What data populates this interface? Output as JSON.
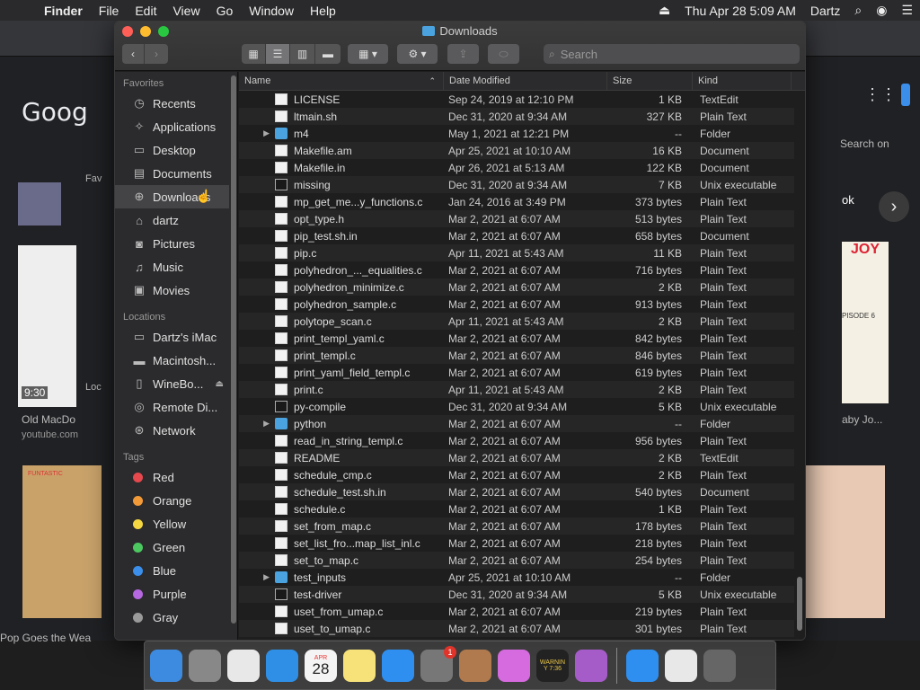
{
  "menubar": {
    "app": "Finder",
    "items": [
      "File",
      "Edit",
      "View",
      "Go",
      "Window",
      "Help"
    ],
    "clock": "Thu Apr 28  5:09 AM",
    "user": "Dartz"
  },
  "background": {
    "google": "Goog",
    "search_on": "Search on",
    "video_time": "9:30",
    "video_title": "Old MacDo",
    "video_source": "youtube.com",
    "bottom_caption": "Pop Goes the Wea",
    "right_caption": "aby Jo...",
    "right_caption2": "ok",
    "sidebar_hint": "Fav",
    "loc_hint": "Loc",
    "thumb_label": "JOY",
    "thumb_label2": "PISODE 6",
    "thumb_label3": "FUNTASTIC"
  },
  "finder": {
    "title": "Downloads",
    "search_placeholder": "Search",
    "columns": {
      "name": "Name",
      "date": "Date Modified",
      "size": "Size",
      "kind": "Kind"
    },
    "sidebar": {
      "favorites_label": "Favorites",
      "favorites": [
        {
          "label": "Recents",
          "icon": "clock-icon"
        },
        {
          "label": "Applications",
          "icon": "applications-icon"
        },
        {
          "label": "Desktop",
          "icon": "desktop-icon"
        },
        {
          "label": "Documents",
          "icon": "documents-icon"
        },
        {
          "label": "Downloads",
          "icon": "downloads-icon"
        },
        {
          "label": "dartz",
          "icon": "home-icon"
        },
        {
          "label": "Pictures",
          "icon": "pictures-icon"
        },
        {
          "label": "Music",
          "icon": "music-icon"
        },
        {
          "label": "Movies",
          "icon": "movies-icon"
        }
      ],
      "locations_label": "Locations",
      "locations": [
        {
          "label": "Dartz's iMac",
          "icon": "imac-icon"
        },
        {
          "label": "Macintosh...",
          "icon": "disk-icon"
        },
        {
          "label": "WineBo...",
          "icon": "drive-icon"
        },
        {
          "label": "Remote Di...",
          "icon": "disc-icon"
        },
        {
          "label": "Network",
          "icon": "network-icon"
        }
      ],
      "tags_label": "Tags",
      "tags": [
        {
          "label": "Red",
          "color": "#e5484d"
        },
        {
          "label": "Orange",
          "color": "#f29a38"
        },
        {
          "label": "Yellow",
          "color": "#f5d742"
        },
        {
          "label": "Green",
          "color": "#4cc861"
        },
        {
          "label": "Blue",
          "color": "#3b8eea"
        },
        {
          "label": "Purple",
          "color": "#b568e0"
        },
        {
          "label": "Gray",
          "color": "#9a9a9a"
        }
      ]
    },
    "files": [
      {
        "name": "LICENSE",
        "date": "Sep 24, 2019 at 12:10 PM",
        "size": "1 KB",
        "kind": "TextEdit",
        "type": "doc"
      },
      {
        "name": "ltmain.sh",
        "date": "Dec 31, 2020 at 9:34 AM",
        "size": "327 KB",
        "kind": "Plain Text",
        "type": "doc"
      },
      {
        "name": "m4",
        "date": "May 1, 2021 at 12:21 PM",
        "size": "--",
        "kind": "Folder",
        "type": "folder"
      },
      {
        "name": "Makefile.am",
        "date": "Apr 25, 2021 at 10:10 AM",
        "size": "16 KB",
        "kind": "Document",
        "type": "doc"
      },
      {
        "name": "Makefile.in",
        "date": "Apr 26, 2021 at 5:13 AM",
        "size": "122 KB",
        "kind": "Document",
        "type": "doc"
      },
      {
        "name": "missing",
        "date": "Dec 31, 2020 at 9:34 AM",
        "size": "7 KB",
        "kind": "Unix executable",
        "type": "exec"
      },
      {
        "name": "mp_get_me...y_functions.c",
        "date": "Jan 24, 2016 at 3:49 PM",
        "size": "373 bytes",
        "kind": "Plain Text",
        "type": "doc"
      },
      {
        "name": "opt_type.h",
        "date": "Mar 2, 2021 at 6:07 AM",
        "size": "513 bytes",
        "kind": "Plain Text",
        "type": "doc"
      },
      {
        "name": "pip_test.sh.in",
        "date": "Mar 2, 2021 at 6:07 AM",
        "size": "658 bytes",
        "kind": "Document",
        "type": "doc"
      },
      {
        "name": "pip.c",
        "date": "Apr 11, 2021 at 5:43 AM",
        "size": "11 KB",
        "kind": "Plain Text",
        "type": "doc"
      },
      {
        "name": "polyhedron_..._equalities.c",
        "date": "Mar 2, 2021 at 6:07 AM",
        "size": "716 bytes",
        "kind": "Plain Text",
        "type": "doc"
      },
      {
        "name": "polyhedron_minimize.c",
        "date": "Mar 2, 2021 at 6:07 AM",
        "size": "2 KB",
        "kind": "Plain Text",
        "type": "doc"
      },
      {
        "name": "polyhedron_sample.c",
        "date": "Mar 2, 2021 at 6:07 AM",
        "size": "913 bytes",
        "kind": "Plain Text",
        "type": "doc"
      },
      {
        "name": "polytope_scan.c",
        "date": "Apr 11, 2021 at 5:43 AM",
        "size": "2 KB",
        "kind": "Plain Text",
        "type": "doc"
      },
      {
        "name": "print_templ_yaml.c",
        "date": "Mar 2, 2021 at 6:07 AM",
        "size": "842 bytes",
        "kind": "Plain Text",
        "type": "doc"
      },
      {
        "name": "print_templ.c",
        "date": "Mar 2, 2021 at 6:07 AM",
        "size": "846 bytes",
        "kind": "Plain Text",
        "type": "doc"
      },
      {
        "name": "print_yaml_field_templ.c",
        "date": "Mar 2, 2021 at 6:07 AM",
        "size": "619 bytes",
        "kind": "Plain Text",
        "type": "doc"
      },
      {
        "name": "print.c",
        "date": "Apr 11, 2021 at 5:43 AM",
        "size": "2 KB",
        "kind": "Plain Text",
        "type": "doc"
      },
      {
        "name": "py-compile",
        "date": "Dec 31, 2020 at 9:34 AM",
        "size": "5 KB",
        "kind": "Unix executable",
        "type": "exec"
      },
      {
        "name": "python",
        "date": "Mar 2, 2021 at 6:07 AM",
        "size": "--",
        "kind": "Folder",
        "type": "folder"
      },
      {
        "name": "read_in_string_templ.c",
        "date": "Mar 2, 2021 at 6:07 AM",
        "size": "956 bytes",
        "kind": "Plain Text",
        "type": "doc"
      },
      {
        "name": "README",
        "date": "Mar 2, 2021 at 6:07 AM",
        "size": "2 KB",
        "kind": "TextEdit",
        "type": "doc"
      },
      {
        "name": "schedule_cmp.c",
        "date": "Mar 2, 2021 at 6:07 AM",
        "size": "2 KB",
        "kind": "Plain Text",
        "type": "doc"
      },
      {
        "name": "schedule_test.sh.in",
        "date": "Mar 2, 2021 at 6:07 AM",
        "size": "540 bytes",
        "kind": "Document",
        "type": "doc"
      },
      {
        "name": "schedule.c",
        "date": "Mar 2, 2021 at 6:07 AM",
        "size": "1 KB",
        "kind": "Plain Text",
        "type": "doc"
      },
      {
        "name": "set_from_map.c",
        "date": "Mar 2, 2021 at 6:07 AM",
        "size": "178 bytes",
        "kind": "Plain Text",
        "type": "doc"
      },
      {
        "name": "set_list_fro...map_list_inl.c",
        "date": "Mar 2, 2021 at 6:07 AM",
        "size": "218 bytes",
        "kind": "Plain Text",
        "type": "doc"
      },
      {
        "name": "set_to_map.c",
        "date": "Mar 2, 2021 at 6:07 AM",
        "size": "254 bytes",
        "kind": "Plain Text",
        "type": "doc"
      },
      {
        "name": "test_inputs",
        "date": "Apr 25, 2021 at 10:10 AM",
        "size": "--",
        "kind": "Folder",
        "type": "folder"
      },
      {
        "name": "test-driver",
        "date": "Dec 31, 2020 at 9:34 AM",
        "size": "5 KB",
        "kind": "Unix executable",
        "type": "exec"
      },
      {
        "name": "uset_from_umap.c",
        "date": "Mar 2, 2021 at 6:07 AM",
        "size": "219 bytes",
        "kind": "Plain Text",
        "type": "doc"
      },
      {
        "name": "uset_to_umap.c",
        "date": "Mar 2, 2021 at 6:07 AM",
        "size": "301 bytes",
        "kind": "Plain Text",
        "type": "doc"
      }
    ]
  },
  "dock": {
    "calendar_month": "APR",
    "calendar_day": "28",
    "sysprefs_badge": "1",
    "console_text1": "WARNIN",
    "console_text2": "Y 7:36",
    "apps": [
      {
        "name": "finder-icon",
        "color": "#3d8be0"
      },
      {
        "name": "launchpad-icon",
        "color": "#888"
      },
      {
        "name": "chrome-icon",
        "color": "#e8e8e8"
      },
      {
        "name": "safari-icon",
        "color": "#2f8fe6"
      },
      {
        "name": "calendar-icon",
        "color": "#f4f4f4"
      },
      {
        "name": "notes-icon",
        "color": "#f7e27a"
      },
      {
        "name": "appstore-icon",
        "color": "#2e8ff0"
      },
      {
        "name": "system-preferences-icon",
        "color": "#777"
      },
      {
        "name": "archive-utility-icon",
        "color": "#b07a4e"
      },
      {
        "name": "colorsync-icon",
        "color": "#d66adf"
      },
      {
        "name": "console-icon",
        "color": "#222"
      },
      {
        "name": "potion-icon",
        "color": "#a55cc8"
      },
      {
        "name": "appstore-downloads-icon",
        "color": "#2e8ff0"
      },
      {
        "name": "document-icon",
        "color": "#e8e8e8"
      },
      {
        "name": "trash-icon",
        "color": "#666"
      }
    ]
  }
}
